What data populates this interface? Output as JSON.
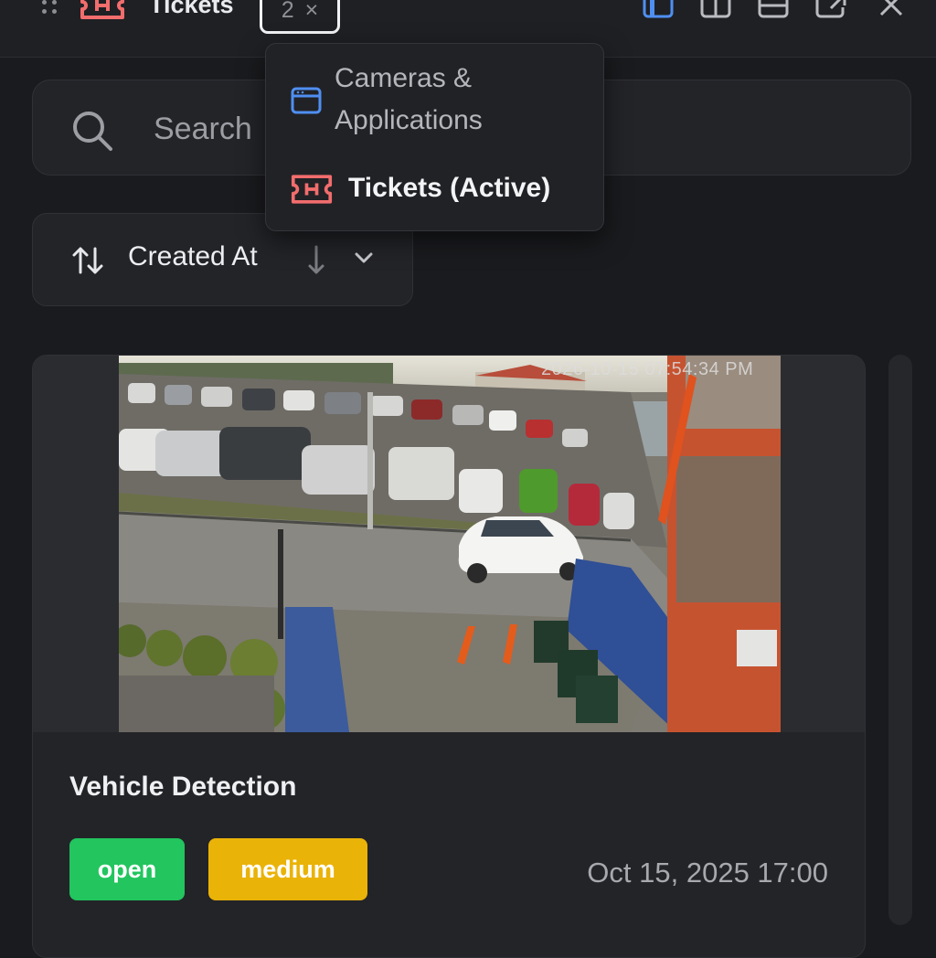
{
  "header": {
    "title": "Tickets",
    "count": "2",
    "count_close": "×"
  },
  "search": {
    "placeholder": "Search"
  },
  "dropdown": {
    "items": [
      {
        "label_line1": "Cameras &",
        "label_line2": "Applications",
        "icon": "browser-window-icon",
        "active": false
      },
      {
        "label": "Tickets (Active)",
        "icon": "ticket-icon",
        "active": true
      }
    ]
  },
  "sort": {
    "label": "Created At",
    "direction": "descending"
  },
  "ticket": {
    "title": "Vehicle Detection",
    "status": "open",
    "priority": "medium",
    "date": "Oct 15, 2025 17:00",
    "camera_timestamp": "2026-10-15 07:54:34 PM"
  },
  "colors": {
    "accent_blue": "#4f8ff2",
    "ticket_red": "#f26d6d",
    "badge_open": "#22c55e",
    "badge_medium": "#eab308"
  }
}
